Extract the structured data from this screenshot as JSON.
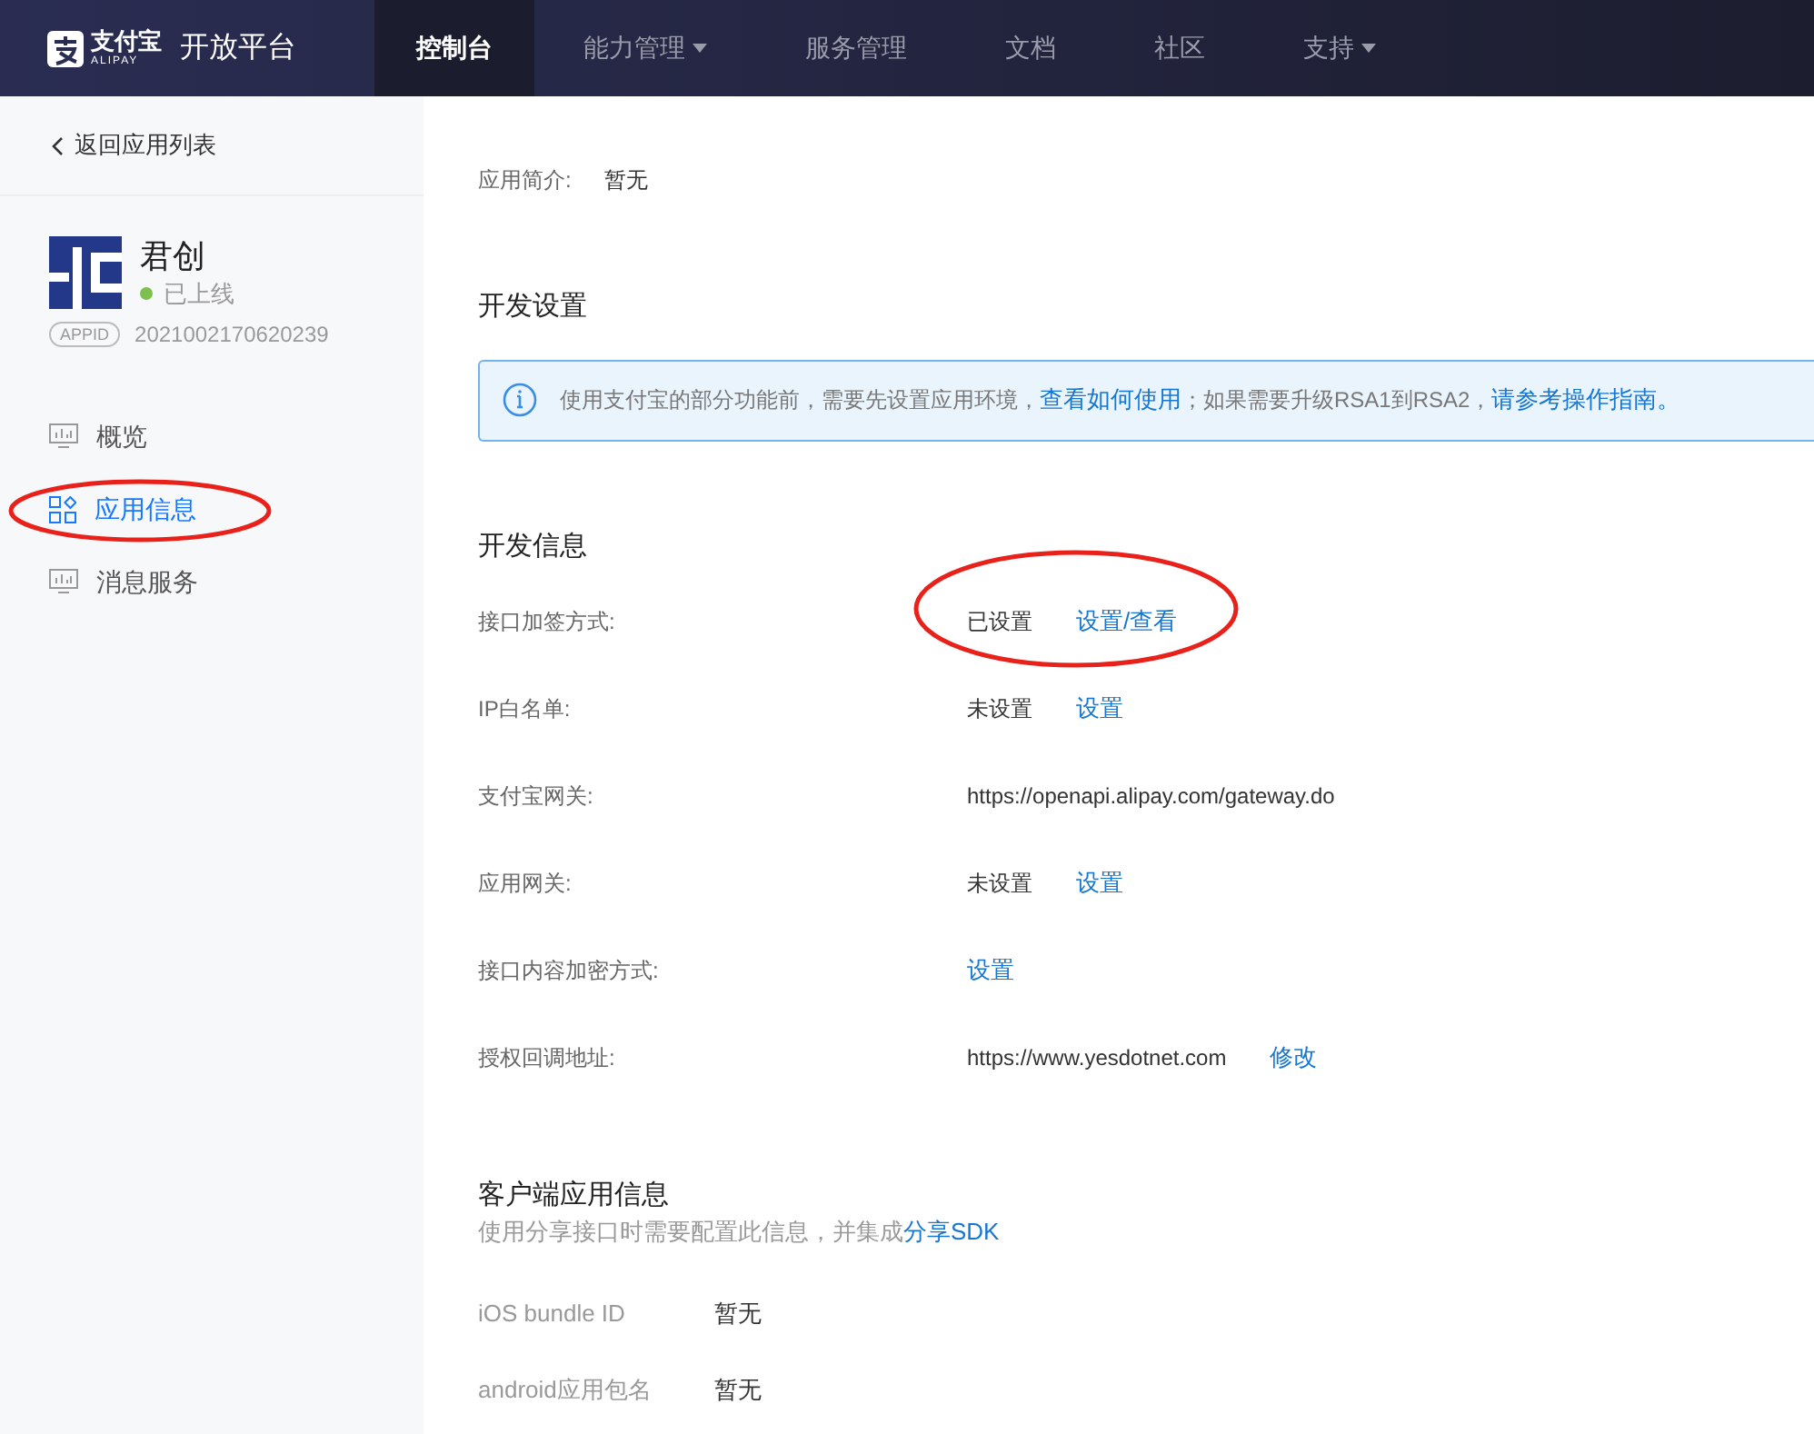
{
  "top_nav": {
    "brand": {
      "name": "支付宝",
      "sub": "ALIPAY"
    },
    "platform": "开放平台",
    "tabs": [
      {
        "label": "控制台",
        "selected": true,
        "dropdown": false
      },
      {
        "label": "能力管理",
        "selected": false,
        "dropdown": true
      },
      {
        "label": "服务管理",
        "selected": false,
        "dropdown": false
      },
      {
        "label": "文档",
        "selected": false,
        "dropdown": false
      },
      {
        "label": "社区",
        "selected": false,
        "dropdown": false
      },
      {
        "label": "支持",
        "selected": false,
        "dropdown": true
      }
    ]
  },
  "sidebar": {
    "back": "返回应用列表",
    "app": {
      "name": "君创",
      "status": "已上线",
      "appid_badge": "APPID",
      "appid": "2021002170620239"
    },
    "items": [
      {
        "label": "概览",
        "selected": false,
        "circled": false
      },
      {
        "label": "应用信息",
        "selected": true,
        "circled": true
      },
      {
        "label": "消息服务",
        "selected": false,
        "circled": false
      }
    ]
  },
  "intro": {
    "label": "应用简介:",
    "value": "暂无"
  },
  "dev_settings": {
    "title": "开发设置",
    "notice": [
      {
        "kind": "text",
        "text": "使用支付宝的部分功能前，需要先设置应用环境，"
      },
      {
        "kind": "link",
        "text": "查看如何使用"
      },
      {
        "kind": "text",
        "text": "；如果需要升级RSA1到RSA2，"
      },
      {
        "kind": "link",
        "text": "请参考操作指南。"
      }
    ]
  },
  "dev_info": {
    "title": "开发信息",
    "rows": [
      {
        "label": "接口加签方式:",
        "value": "已设置",
        "links": [
          "设置/查看"
        ],
        "circled": true
      },
      {
        "label": "IP白名单:",
        "value": "未设置",
        "links": [
          "设置"
        ],
        "circled": false
      },
      {
        "label": "支付宝网关:",
        "value": "https://openapi.alipay.com/gateway.do",
        "links": [],
        "circled": false
      },
      {
        "label": "应用网关:",
        "value": "未设置",
        "links": [
          "设置"
        ],
        "circled": false
      },
      {
        "label": "接口内容加密方式:",
        "links": [
          "设置"
        ],
        "circled": false
      },
      {
        "label": "授权回调地址:",
        "value": "https://www.yesdotnet.com",
        "links": [
          "修改"
        ],
        "circled": false
      }
    ]
  },
  "client_info": {
    "title": "客户端应用信息",
    "hint": [
      {
        "kind": "text",
        "text": "使用分享接口时需要配置此信息，并集成"
      },
      {
        "kind": "link",
        "text": "分享SDK"
      }
    ],
    "rows": [
      {
        "label": "iOS bundle ID",
        "value": "暂无"
      },
      {
        "label": "android应用包名",
        "value": "暂无"
      }
    ]
  }
}
